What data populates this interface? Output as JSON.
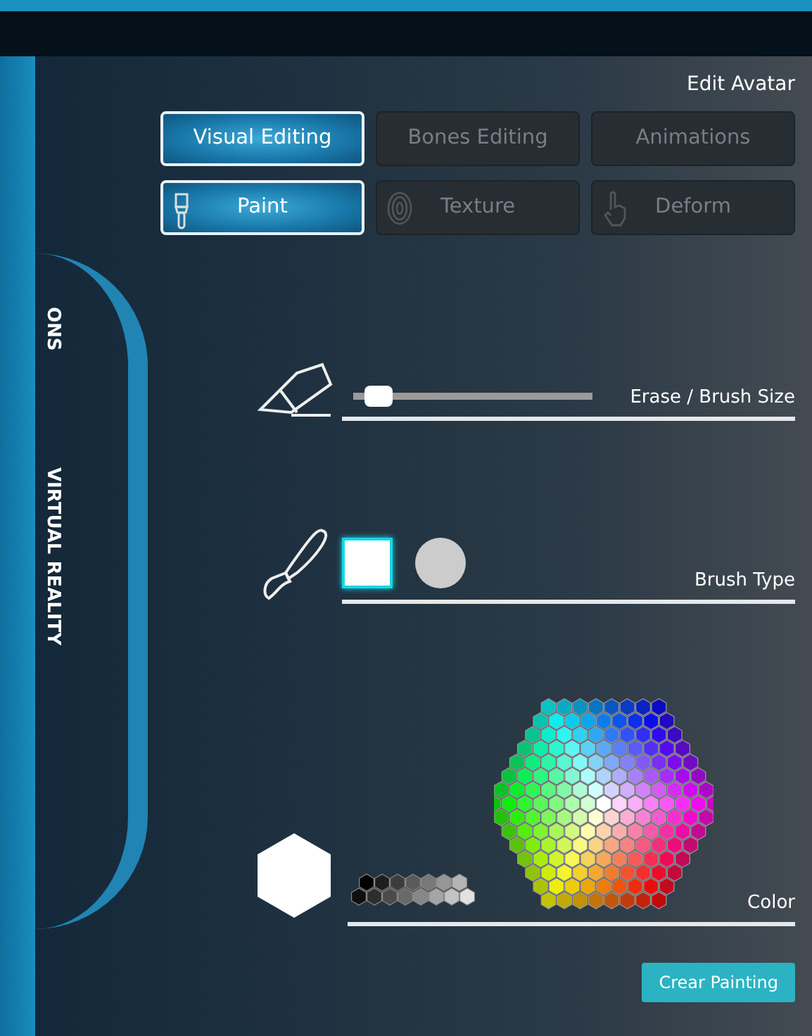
{
  "background_labels": [
    {
      "text": "ONS"
    },
    {
      "text": "VIRTUAL REALITY"
    }
  ],
  "title": "Edit Avatar",
  "mode_tabs": [
    {
      "label": "Visual Editing",
      "selected": true
    },
    {
      "label": "Bones Editing",
      "selected": false
    },
    {
      "label": "Animations",
      "selected": false
    }
  ],
  "tools": [
    {
      "label": "Paint",
      "kind": "brush",
      "selected": true
    },
    {
      "label": "Texture",
      "kind": "fingerprint",
      "selected": false
    },
    {
      "label": "Deform",
      "kind": "hand",
      "selected": false
    }
  ],
  "size_section": {
    "label": "Erase / Brush Size",
    "level": 0.05
  },
  "brush_section": {
    "label": "Brush Type",
    "shapes": [
      {
        "kind": "square",
        "selected": true
      },
      {
        "kind": "circle",
        "selected": false
      }
    ]
  },
  "color_section": {
    "label": "Color"
  },
  "clear_button": "Crear Painting"
}
